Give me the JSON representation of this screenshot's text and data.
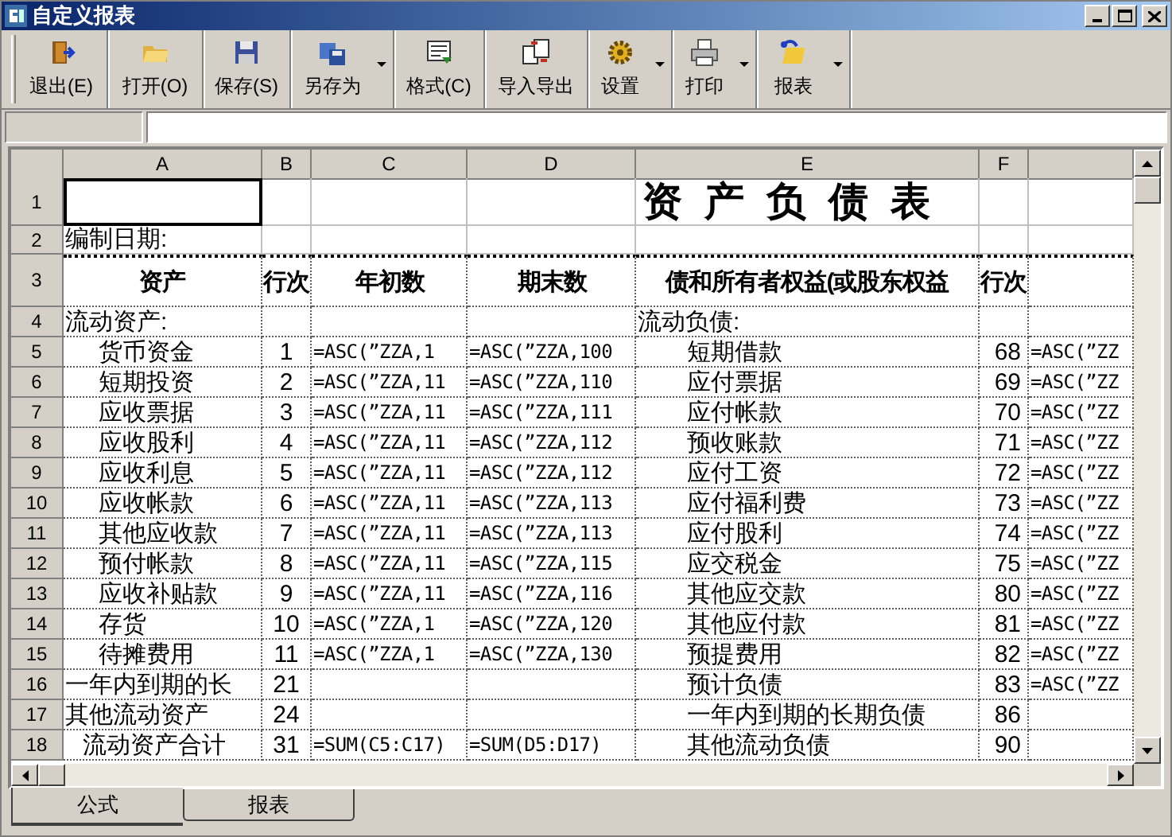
{
  "window": {
    "title": "自定义报表"
  },
  "toolbar": [
    {
      "label": "退出(E)",
      "dropdown": false
    },
    {
      "label": "打开(O)",
      "dropdown": false
    },
    {
      "label": "保存(S)",
      "dropdown": false
    },
    {
      "label": "另存为",
      "dropdown": true
    },
    {
      "label": "格式(C)",
      "dropdown": false
    },
    {
      "label": "导入导出",
      "dropdown": false
    },
    {
      "label": "设置",
      "dropdown": true
    },
    {
      "label": "打印",
      "dropdown": true
    },
    {
      "label": "报表",
      "dropdown": true
    }
  ],
  "sheet": {
    "columns": [
      "A",
      "B",
      "C",
      "D",
      "E",
      "F"
    ],
    "rows": [
      {
        "number": "1",
        "cells": [
          {
            "selected": true
          },
          {
            "selected": false
          },
          {
            "selected": false
          },
          {
            "selected": false
          },
          {
            "text": "资产负债表",
            "kind": "title",
            "selected": false
          },
          {
            "selected": false
          },
          {
            "selected": false
          }
        ]
      },
      {
        "number": "2",
        "cells": [
          {
            "text": "编制日期:",
            "kind": "section",
            "selected": false
          },
          {
            "selected": false
          },
          {
            "selected": false
          },
          {
            "selected": false
          },
          {
            "selected": false
          },
          {
            "selected": false
          },
          {
            "selected": false
          }
        ]
      },
      {
        "number": "3",
        "cells": [
          {
            "text": "资产",
            "kind": "header",
            "selected": false
          },
          {
            "text": "行次",
            "kind": "header",
            "selected": false
          },
          {
            "text": "年初数",
            "kind": "header",
            "selected": false
          },
          {
            "text": "期末数",
            "kind": "header",
            "selected": false
          },
          {
            "text": "债和所有者权益(或股东权益",
            "kind": "header",
            "selected": false
          },
          {
            "text": "行次",
            "kind": "header",
            "selected": false
          },
          {
            "selected": false
          }
        ]
      },
      {
        "number": "4",
        "cells": [
          {
            "text": "流动资产:",
            "kind": "section",
            "selected": false
          },
          {
            "selected": false
          },
          {
            "selected": false
          },
          {
            "selected": false
          },
          {
            "text": "流动负债:",
            "kind": "section",
            "selected": false
          },
          {
            "selected": false
          },
          {
            "selected": false
          }
        ]
      },
      {
        "number": "5",
        "cells": [
          {
            "text": "货币资金",
            "kind": "item",
            "selected": false
          },
          {
            "text": "1",
            "selected": false
          },
          {
            "text": "=ASC(”ZZA,1",
            "selected": false
          },
          {
            "text": "=ASC(”ZZA,100",
            "selected": false
          },
          {
            "text": "短期借款",
            "kind": "item",
            "selected": false
          },
          {
            "text": "68",
            "selected": false
          },
          {
            "text": "=ASC(”ZZ",
            "selected": false
          }
        ]
      },
      {
        "number": "6",
        "cells": [
          {
            "text": "短期投资",
            "kind": "item",
            "selected": false
          },
          {
            "text": "2",
            "selected": false
          },
          {
            "text": "=ASC(”ZZA,11",
            "selected": false
          },
          {
            "text": "=ASC(”ZZA,110",
            "selected": false
          },
          {
            "text": "应付票据",
            "kind": "item",
            "selected": false
          },
          {
            "text": "69",
            "selected": false
          },
          {
            "text": "=ASC(”ZZ",
            "selected": false
          }
        ]
      },
      {
        "number": "7",
        "cells": [
          {
            "text": "应收票据",
            "kind": "item",
            "selected": false
          },
          {
            "text": "3",
            "selected": false
          },
          {
            "text": "=ASC(”ZZA,11",
            "selected": false
          },
          {
            "text": "=ASC(”ZZA,111",
            "selected": false
          },
          {
            "text": "应付帐款",
            "kind": "item",
            "selected": false
          },
          {
            "text": "70",
            "selected": false
          },
          {
            "text": "=ASC(”ZZ",
            "selected": false
          }
        ]
      },
      {
        "number": "8",
        "cells": [
          {
            "text": "应收股利",
            "kind": "item",
            "selected": false
          },
          {
            "text": "4",
            "selected": false
          },
          {
            "text": "=ASC(”ZZA,11",
            "selected": false
          },
          {
            "text": "=ASC(”ZZA,112",
            "selected": false
          },
          {
            "text": "预收账款",
            "kind": "item",
            "selected": false
          },
          {
            "text": "71",
            "selected": false
          },
          {
            "text": "=ASC(”ZZ",
            "selected": false
          }
        ]
      },
      {
        "number": "9",
        "cells": [
          {
            "text": "应收利息",
            "kind": "item",
            "selected": false
          },
          {
            "text": "5",
            "selected": false
          },
          {
            "text": "=ASC(”ZZA,11",
            "selected": false
          },
          {
            "text": "=ASC(”ZZA,112",
            "selected": false
          },
          {
            "text": "应付工资",
            "kind": "item",
            "selected": false
          },
          {
            "text": "72",
            "selected": false
          },
          {
            "text": "=ASC(”ZZ",
            "selected": false
          }
        ]
      },
      {
        "number": "10",
        "cells": [
          {
            "text": "应收帐款",
            "kind": "item",
            "selected": false
          },
          {
            "text": "6",
            "selected": false
          },
          {
            "text": "=ASC(”ZZA,11",
            "selected": false
          },
          {
            "text": "=ASC(”ZZA,113",
            "selected": false
          },
          {
            "text": "应付福利费",
            "kind": "item",
            "selected": false
          },
          {
            "text": "73",
            "selected": false
          },
          {
            "text": "=ASC(”ZZ",
            "selected": false
          }
        ]
      },
      {
        "number": "11",
        "cells": [
          {
            "text": "其他应收款",
            "kind": "item",
            "selected": false
          },
          {
            "text": "7",
            "selected": false
          },
          {
            "text": "=ASC(”ZZA,11",
            "selected": false
          },
          {
            "text": "=ASC(”ZZA,113",
            "selected": false
          },
          {
            "text": "应付股利",
            "kind": "item",
            "selected": false
          },
          {
            "text": "74",
            "selected": false
          },
          {
            "text": "=ASC(”ZZ",
            "selected": false
          }
        ]
      },
      {
        "number": "12",
        "cells": [
          {
            "text": "预付帐款",
            "kind": "item",
            "selected": false
          },
          {
            "text": "8",
            "selected": false
          },
          {
            "text": "=ASC(”ZZA,11",
            "selected": false
          },
          {
            "text": "=ASC(”ZZA,115",
            "selected": false
          },
          {
            "text": "应交税金",
            "kind": "item",
            "selected": false
          },
          {
            "text": "75",
            "selected": false
          },
          {
            "text": "=ASC(”ZZ",
            "selected": false
          }
        ]
      },
      {
        "number": "13",
        "cells": [
          {
            "text": "应收补贴款",
            "kind": "item",
            "selected": false
          },
          {
            "text": "9",
            "selected": false
          },
          {
            "text": "=ASC(”ZZA,11",
            "selected": false
          },
          {
            "text": "=ASC(”ZZA,116",
            "selected": false
          },
          {
            "text": "其他应交款",
            "kind": "item",
            "selected": false
          },
          {
            "text": "80",
            "selected": false
          },
          {
            "text": "=ASC(”ZZ",
            "selected": false
          }
        ]
      },
      {
        "number": "14",
        "cells": [
          {
            "text": "存货",
            "kind": "item",
            "selected": false
          },
          {
            "text": "10",
            "selected": false
          },
          {
            "text": "=ASC(”ZZA,1",
            "selected": false
          },
          {
            "text": "=ASC(”ZZA,120",
            "selected": false
          },
          {
            "text": "其他应付款",
            "kind": "item",
            "selected": false
          },
          {
            "text": "81",
            "selected": false
          },
          {
            "text": "=ASC(”ZZ",
            "selected": false
          }
        ]
      },
      {
        "number": "15",
        "cells": [
          {
            "text": "待摊费用",
            "kind": "item",
            "selected": false
          },
          {
            "text": "11",
            "selected": false
          },
          {
            "text": "=ASC(”ZZA,1",
            "selected": false
          },
          {
            "text": "=ASC(”ZZA,130",
            "selected": false
          },
          {
            "text": "预提费用",
            "kind": "item",
            "selected": false
          },
          {
            "text": "82",
            "selected": false
          },
          {
            "text": "=ASC(”ZZ",
            "selected": false
          }
        ]
      },
      {
        "number": "16",
        "cells": [
          {
            "text": "一年内到期的长",
            "kind": "section",
            "selected": false
          },
          {
            "text": "21",
            "selected": false
          },
          {
            "selected": false
          },
          {
            "selected": false
          },
          {
            "text": "预计负债",
            "kind": "item",
            "selected": false
          },
          {
            "text": "83",
            "selected": false
          },
          {
            "text": "=ASC(”ZZ",
            "selected": false
          }
        ]
      },
      {
        "number": "17",
        "cells": [
          {
            "text": "其他流动资产",
            "kind": "section",
            "selected": false
          },
          {
            "text": "24",
            "selected": false
          },
          {
            "selected": false
          },
          {
            "selected": false
          },
          {
            "text": "一年内到期的长期负债",
            "kind": "item",
            "selected": false
          },
          {
            "text": "86",
            "selected": false
          },
          {
            "selected": false
          }
        ]
      },
      {
        "number": "18",
        "cells": [
          {
            "text": "流动资产合计",
            "kind": "total",
            "selected": false
          },
          {
            "text": "31",
            "selected": false
          },
          {
            "text": "=SUM(C5:C17)",
            "selected": false
          },
          {
            "text": "=SUM(D5:D17)",
            "selected": false
          },
          {
            "text": "其他流动负债",
            "kind": "item",
            "selected": false
          },
          {
            "text": "90",
            "selected": false
          },
          {
            "selected": false
          }
        ]
      }
    ]
  },
  "sheet_tabs": [
    {
      "label": "公式",
      "selected": true
    },
    {
      "label": "报表",
      "selected": false
    }
  ]
}
